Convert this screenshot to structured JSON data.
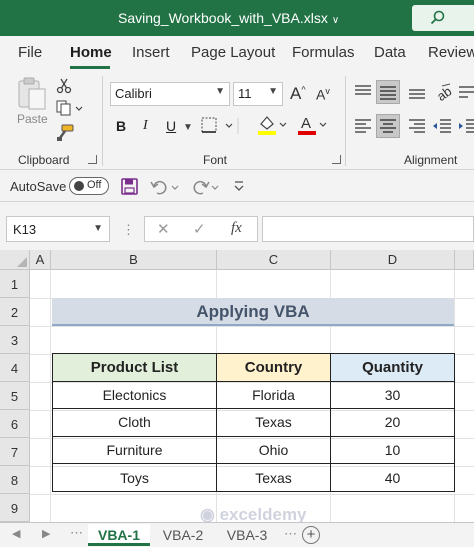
{
  "window": {
    "title": "Saving_Workbook_with_VBA.xlsx"
  },
  "ribbon_tabs": [
    "File",
    "Home",
    "Insert",
    "Page Layout",
    "Formulas",
    "Data",
    "Review"
  ],
  "ribbon": {
    "paste_label": "Paste",
    "clipboard_label": "Clipboard",
    "font_label": "Font",
    "alignment_label": "Alignment",
    "font_name": "Calibri",
    "font_size": "11",
    "bold": "B",
    "italic": "I",
    "underline": "U"
  },
  "qat": {
    "autosave_label": "AutoSave",
    "autosave_state": "Off"
  },
  "formula_bar": {
    "name_box": "K13",
    "fx": "fx",
    "value": ""
  },
  "grid": {
    "columns": [
      "A",
      "B",
      "C",
      "D"
    ],
    "rows": [
      "1",
      "2",
      "3",
      "4",
      "5",
      "6",
      "7",
      "8",
      "9"
    ]
  },
  "sheet": {
    "title": "Applying VBA",
    "headers": [
      "Product List",
      "Country",
      "Quantity"
    ],
    "rows": [
      [
        "Electonics",
        "Florida",
        "30"
      ],
      [
        "Cloth",
        "Texas",
        "20"
      ],
      [
        "Furniture",
        "Ohio",
        "10"
      ],
      [
        "Toys",
        "Texas",
        "40"
      ]
    ]
  },
  "sheet_tabs": [
    "VBA-1",
    "VBA-2",
    "VBA-3"
  ],
  "watermark": "exceldemy",
  "colors": {
    "excel_green": "#217346",
    "header_b": "#e2efda",
    "header_c": "#fff2cc",
    "header_d": "#ddebf7",
    "title_bg": "#d6dce5"
  }
}
